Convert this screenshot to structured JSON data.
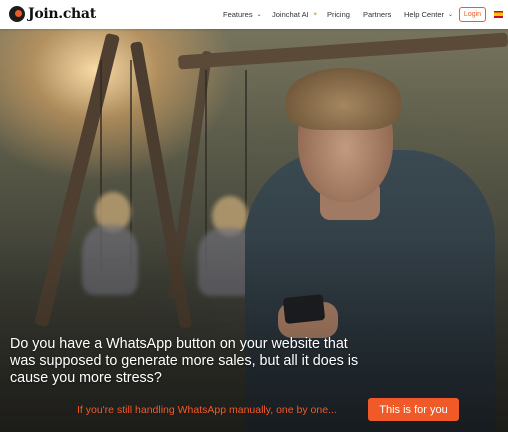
{
  "brand": {
    "name": "Join.chat"
  },
  "nav": {
    "features": "Features",
    "joinchat_ai": "Joinchat AI",
    "pricing": "Pricing",
    "partners": "Partners",
    "help_center": "Help Center",
    "login": "Login",
    "language_flag": "spain-flag-icon"
  },
  "hero": {
    "headline": "Do you have a WhatsApp button on your website that was supposed to generate more sales, but all it does is cause you more stress?",
    "subtext": "If you're still handling WhatsApp manually, one by one...",
    "cta": "This is for you"
  },
  "colors": {
    "accent": "#f05a28",
    "nav_bg": "#ffffff",
    "text_light": "#ffffff"
  }
}
